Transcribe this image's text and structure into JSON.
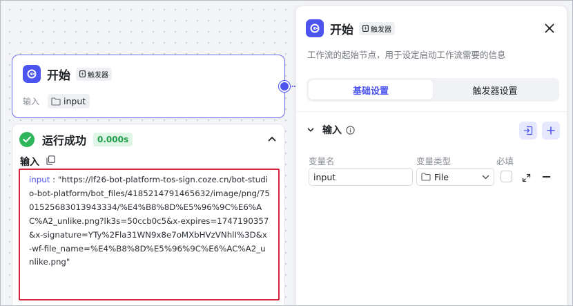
{
  "node": {
    "title": "开始",
    "tag": "触发器",
    "input_label": "输入",
    "input_chip": "input"
  },
  "result": {
    "title": "运行成功",
    "time": "0.000s",
    "section_label": "输入",
    "code_key": "input",
    "code_sep": " : ",
    "code_value": "\"https://lf26-bot-platform-tos-sign.coze.cn/bot-studio-bot-platform/bot_files/4185214791465632/image/png/7501525683013943334/%E4%B8%8D%E5%96%9C%E6%AC%A2_unlike.png?lk3s=50ccb0c5&x-expires=1747190357&x-signature=YTy%2Fla31WN9x8e7oMXbHVzVNhlI%3D&x-wf-file_name=%E4%B8%8D%E5%96%9C%E6%AC%A2_unlike.png\""
  },
  "panel": {
    "title": "开始",
    "tag": "触发器",
    "description": "工作流的起始节点，用于设定启动工作流需要的信息",
    "tabs": [
      {
        "label": "基础设置",
        "active": true
      },
      {
        "label": "触发器设置",
        "active": false
      }
    ],
    "section_title": "输入",
    "columns": {
      "name": "变量名",
      "type": "变量类型",
      "required": "必填"
    },
    "row": {
      "name_value": "input",
      "type_value": "File",
      "required": false
    }
  },
  "icons": [
    "start-node-icon",
    "trigger-icon",
    "folder-icon",
    "check-icon",
    "chevron-up-icon",
    "copy-icon",
    "close-icon",
    "chevron-down-icon",
    "info-icon",
    "import-icon",
    "plus-icon",
    "expand-icon",
    "minus-icon"
  ],
  "colors": {
    "accent": "#4c54f0",
    "success": "#2fb65a",
    "highlight_border": "#d7263d"
  }
}
